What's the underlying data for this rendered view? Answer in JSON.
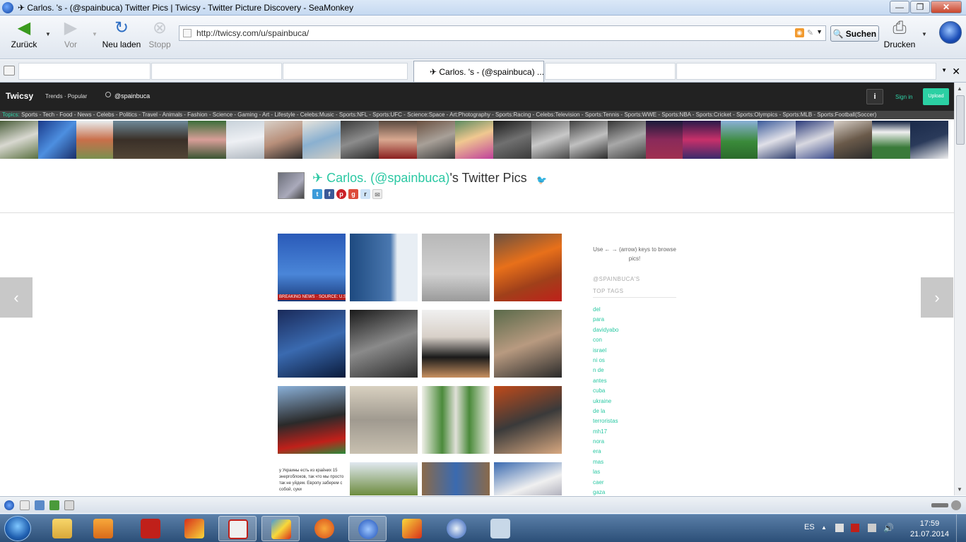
{
  "window": {
    "title": "✈ Carlos. 's - (@spainbuca) Twitter Pics | Twicsy - Twitter Picture Discovery - SeaMonkey",
    "minimize": "—",
    "maximize": "❐",
    "close": "✕"
  },
  "toolbar": {
    "back_label": "Zurück",
    "forward_label": "Vor",
    "reload_label": "Neu laden",
    "stop_label": "Stopp",
    "url": "http://twicsy.com/u/spainbuca/",
    "search_label": "Suchen",
    "print_label": "Drucken"
  },
  "tabs": {
    "active_title": "✈ Carlos. 's - (@spainbuca) ..."
  },
  "site": {
    "logo": "Twicsy",
    "nav": "Trends · Popular",
    "search_text": "@spainbuca",
    "info": "i",
    "signin": "Sign in",
    "upload": "Upload",
    "topics_label": "Topics:",
    "topics": "Sports - Tech - Food - News - Celebs - Politics - Travel - Animals - Fashion - Science - Gaming - Art - Lifestyle - Celebs:Music - Sports:NFL - Sports:UFC - Science:Space - Art:Photography - Sports:Racing - Celebs:Television - Sports:Tennis - Sports:WWE - Sports:NBA - Sports:Cricket - Sports:Olympics - Sports:MLB - Sports:Football(Soccer)"
  },
  "profile": {
    "name_accent": "✈ Carlos. (@spainbuca)",
    "name_rest": "'s Twitter Pics"
  },
  "photos": [
    {
      "caption": "BREAKING NEWS · SOURCE: U.S. CONCLUDES PLANE SHOT D"
    },
    {
      "caption": ""
    },
    {
      "caption": ""
    },
    {
      "caption": ""
    },
    {
      "caption": ""
    },
    {
      "caption": ""
    },
    {
      "caption": ""
    },
    {
      "caption": ""
    },
    {
      "caption": ""
    },
    {
      "caption": ""
    },
    {
      "caption": ""
    },
    {
      "caption": ""
    },
    {
      "caption": "у Украины есть из крайних 15 энергоблоков, так что мы просто так не уйдем. Европу заберем с собой, суки"
    },
    {
      "caption": ""
    },
    {
      "caption": ""
    },
    {
      "caption": ""
    }
  ],
  "sidebar": {
    "hint": "Use ← → (arrow) keys to browse pics!",
    "handle": "@SPAINBUCA'S",
    "tags_title": "TOP TAGS",
    "tags": [
      "del",
      "para",
      "davidyabo",
      "con",
      "israel",
      "ni os",
      "n de",
      "antes",
      "cuba",
      "ukraine",
      "de la",
      "terroristas",
      "mh17",
      "nora",
      "era",
      "mas",
      "las",
      "caer",
      "gaza"
    ]
  },
  "taskbar": {
    "lang": "ES",
    "time": "17:59",
    "date": "21.07.2014"
  },
  "colors": {
    "accent": "#2bc8a3",
    "header_bg": "#222222"
  }
}
